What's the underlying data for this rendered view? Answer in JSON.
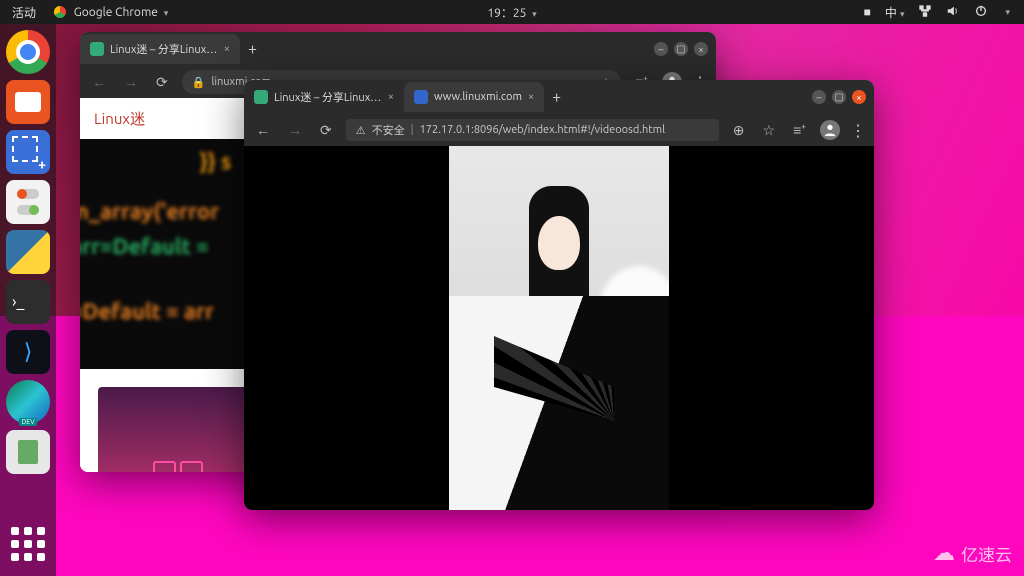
{
  "topbar": {
    "activities": "活动",
    "app": "Google Chrome",
    "clock": "19：25",
    "ime": "中"
  },
  "dock": {
    "items": [
      "chrome",
      "files",
      "screenshot",
      "settings",
      "python",
      "terminal",
      "vscode",
      "edge",
      "trash"
    ]
  },
  "window_back": {
    "tab_title": "Linux迷 – 分享Linux和Py…",
    "url": "linuxmi.com",
    "logo_text": "Linux迷"
  },
  "window_front": {
    "tab1_title": "Linux迷 – 分享Linux和Py…",
    "tab2_title": "www.linuxmi.com",
    "security_label": "不安全",
    "url": "172.17.0.1:8096/web/index.html#!/videoosd.html"
  },
  "watermark": {
    "text": "亿速云"
  }
}
